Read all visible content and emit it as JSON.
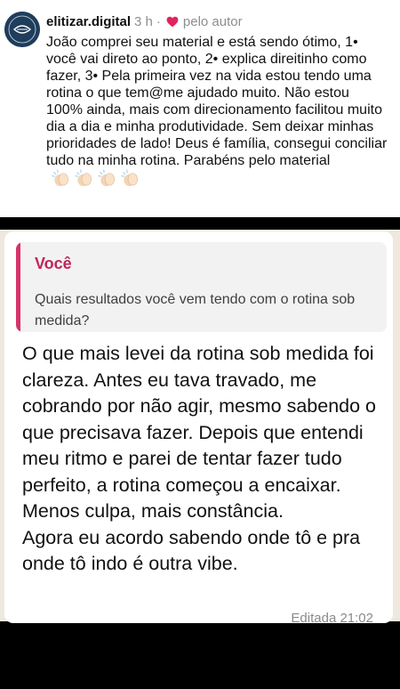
{
  "instagram_comment": {
    "username": "elitizar.digital",
    "time": "3 h",
    "separator": "·",
    "liked_by": "pelo autor",
    "text": "João comprei seu material e está sendo ótimo, 1• você vai direto ao ponto, 2• explica direitinho como fazer, 3• Pela primeira vez na vida estou tendo uma rotina o que tem@me ajudado muito. Não estou 100% ainda, mais com direcionamento facilitou muito dia a dia e minha produtividade. Sem deixar minhas prioridades de lado! Deus é família, consegui conciliar tudo na minha rotina. Parabéns pelo material",
    "emoji": [
      "clapping-hands",
      "clapping-hands",
      "clapping-hands",
      "clapping-hands"
    ],
    "heart_color": "#e0245e"
  },
  "whatsapp_message": {
    "quoted": {
      "author": "Você",
      "text": "Quais resultados você vem tendo com o rotina sob medida?"
    },
    "paragraphs": [
      "O que mais levei da rotina sob medida foi clareza. Antes eu tava travado, me cobrando por não agir, mesmo sabendo o que precisava fazer. Depois que entendi meu ritmo e parei de tentar fazer tudo perfeito, a rotina começou a encaixar. Menos culpa, mais constância.",
      "Agora eu acordo sabendo onde tô e pra onde tô indo é outra vibe."
    ],
    "edited_label": "Editada",
    "time": "21:02",
    "accent_color": "#d6336c",
    "background_color": "#eee8df"
  }
}
